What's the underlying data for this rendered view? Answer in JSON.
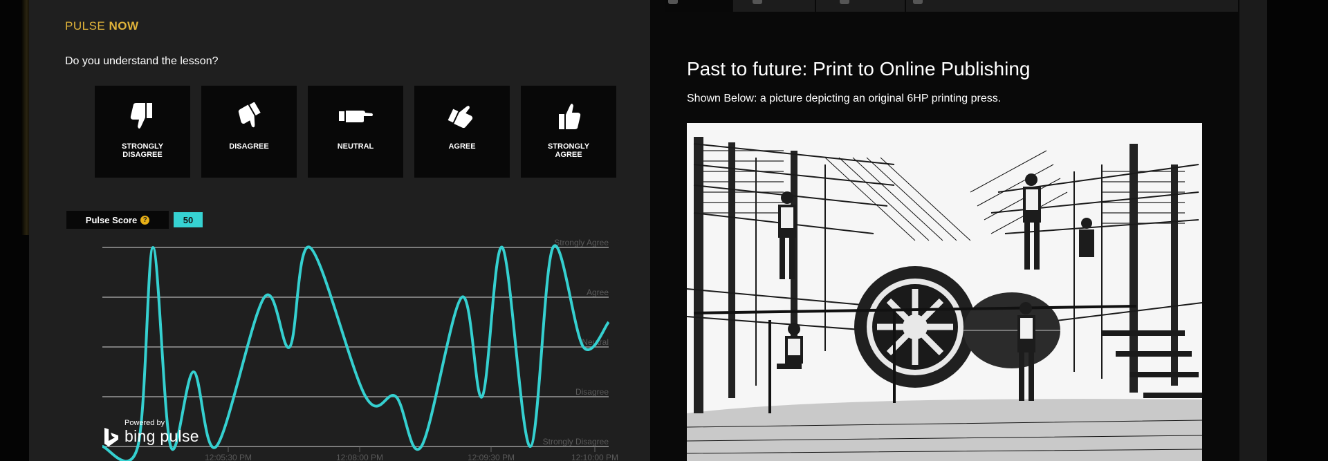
{
  "pulse": {
    "title_prefix": "PULSE",
    "title_emphasis": "NOW",
    "question": "Do you understand the lesson?",
    "options": [
      {
        "label": "STRONGLY DISAGREE",
        "icon": "thumbs-down-icon"
      },
      {
        "label": "DISAGREE",
        "icon": "thumbs-down-tilted-icon"
      },
      {
        "label": "NEUTRAL",
        "icon": "hand-sideways-icon"
      },
      {
        "label": "AGREE",
        "icon": "thumbs-up-tilted-icon"
      },
      {
        "label": "STRONGLY AGREE",
        "icon": "thumbs-up-icon"
      }
    ],
    "score_label": "Pulse Score",
    "score_help_icon": "question-mark-icon",
    "score_value": "50",
    "brand_small": "Powered by",
    "brand_name": "bing pulse"
  },
  "chart_data": {
    "type": "line",
    "title": "",
    "levels": [
      "Strongly Agree",
      "Agree",
      "Neutral",
      "Disagree",
      "Strongly Disagree"
    ],
    "series": [
      {
        "color": "#35d0d0",
        "points": [
          [
            0.0,
            1.0
          ],
          [
            0.07,
            1.0
          ],
          [
            0.1,
            5.0
          ],
          [
            0.135,
            1.0
          ],
          [
            0.18,
            2.5
          ],
          [
            0.225,
            1.0
          ],
          [
            0.32,
            4.0
          ],
          [
            0.37,
            3.0
          ],
          [
            0.41,
            5.0
          ],
          [
            0.52,
            2.0
          ],
          [
            0.58,
            2.0
          ],
          [
            0.63,
            1.0
          ],
          [
            0.71,
            4.0
          ],
          [
            0.75,
            2.0
          ],
          [
            0.79,
            5.0
          ],
          [
            0.845,
            1.0
          ],
          [
            0.89,
            5.0
          ],
          [
            0.95,
            3.0
          ],
          [
            1.0,
            3.5
          ]
        ]
      }
    ],
    "x_tick_labels": [
      "12:05:30 PM",
      "12:08:00 PM",
      "12:09:30 PM",
      "12:10:00 PM"
    ],
    "grid": true
  },
  "content": {
    "tabs": [
      "",
      "",
      "",
      ""
    ],
    "title": "Past to future: Print to Online Publishing",
    "subtitle": "Shown Below: a picture depicting an original 6HP printing press."
  }
}
